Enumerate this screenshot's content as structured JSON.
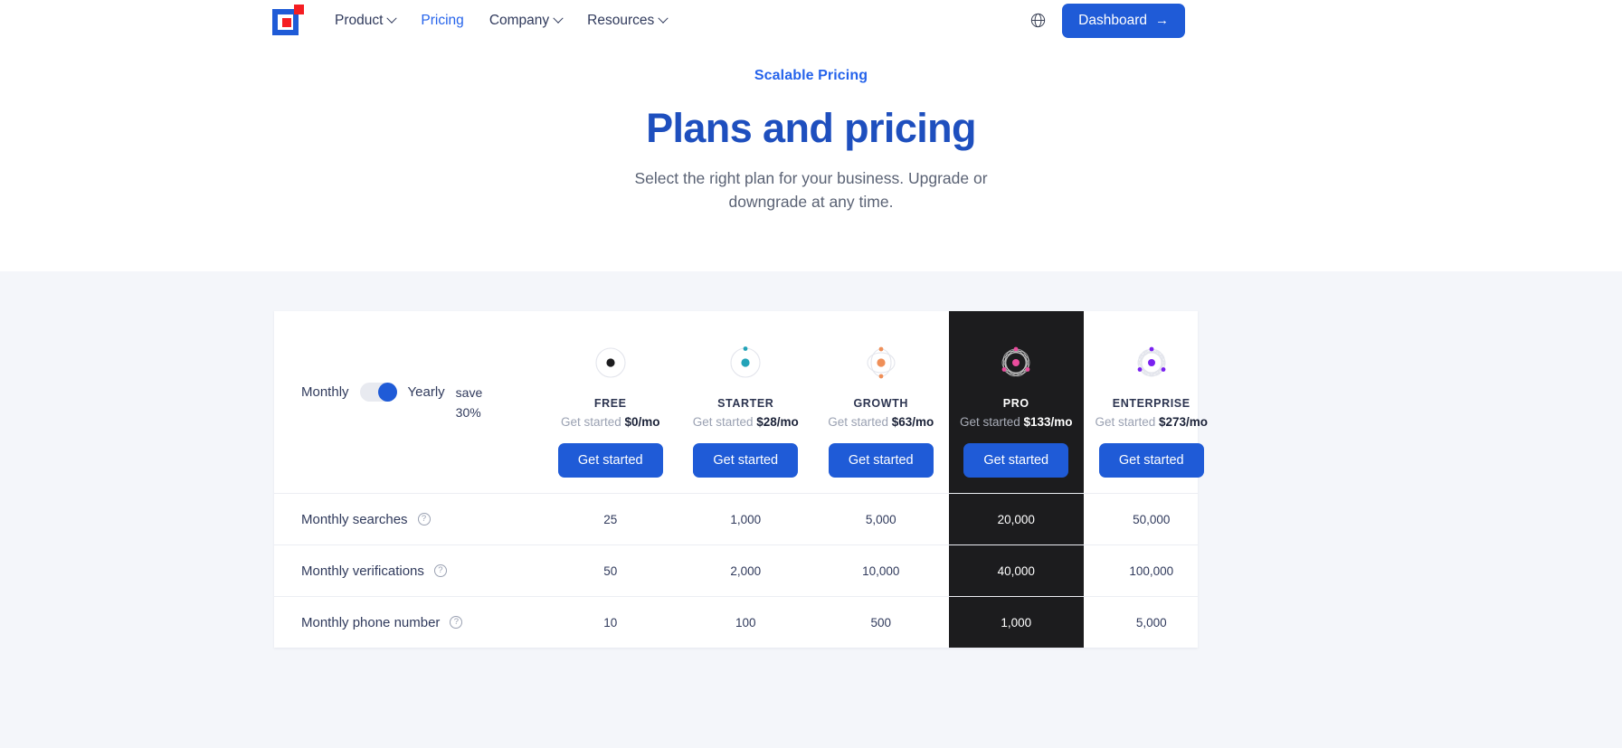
{
  "nav": {
    "logo_name": "brand-logo",
    "items": [
      {
        "label": "Product",
        "has_chevron": true,
        "active": false
      },
      {
        "label": "Pricing",
        "has_chevron": false,
        "active": true
      },
      {
        "label": "Company",
        "has_chevron": true,
        "active": false
      },
      {
        "label": "Resources",
        "has_chevron": true,
        "active": false
      }
    ],
    "language_icon": "globe-icon",
    "dashboard_label": "Dashboard",
    "dashboard_arrow": "→"
  },
  "hero": {
    "eyebrow": "Scalable Pricing",
    "title": "Plans and pricing",
    "subtitle": "Select the right plan for your business. Upgrade or downgrade at any time."
  },
  "pricing": {
    "billing": {
      "monthly_label": "Monthly",
      "yearly_label": "Yearly",
      "selected": "Yearly",
      "save_label": "save 30%"
    },
    "cta_label": "Get started",
    "price_prefix": "Get started",
    "plans": [
      {
        "name": "FREE",
        "price": "$0/mo",
        "accent": "#1c1c1e",
        "rings": 1,
        "highlight": false
      },
      {
        "name": "STARTER",
        "price": "$28/mo",
        "accent": "#23a3b8",
        "rings": 1,
        "highlight": false
      },
      {
        "name": "GROWTH",
        "price": "$63/mo",
        "accent": "#ef8f58",
        "rings": 2,
        "highlight": false
      },
      {
        "name": "PRO",
        "price": "$133/mo",
        "accent": "#ea4c9d",
        "rings": 5,
        "highlight": true
      },
      {
        "name": "ENTERPRISE",
        "price": "$273/mo",
        "accent": "#7a21f0",
        "rings": 6,
        "highlight": false
      }
    ],
    "features": [
      {
        "label": "Monthly searches",
        "help": "?",
        "values": [
          "25",
          "1,000",
          "5,000",
          "20,000",
          "50,000"
        ]
      },
      {
        "label": "Monthly verifications",
        "help": "?",
        "values": [
          "50",
          "2,000",
          "10,000",
          "40,000",
          "100,000"
        ]
      },
      {
        "label": "Monthly phone number",
        "help": "?",
        "values": [
          "10",
          "100",
          "500",
          "1,000",
          "5,000"
        ]
      }
    ]
  }
}
